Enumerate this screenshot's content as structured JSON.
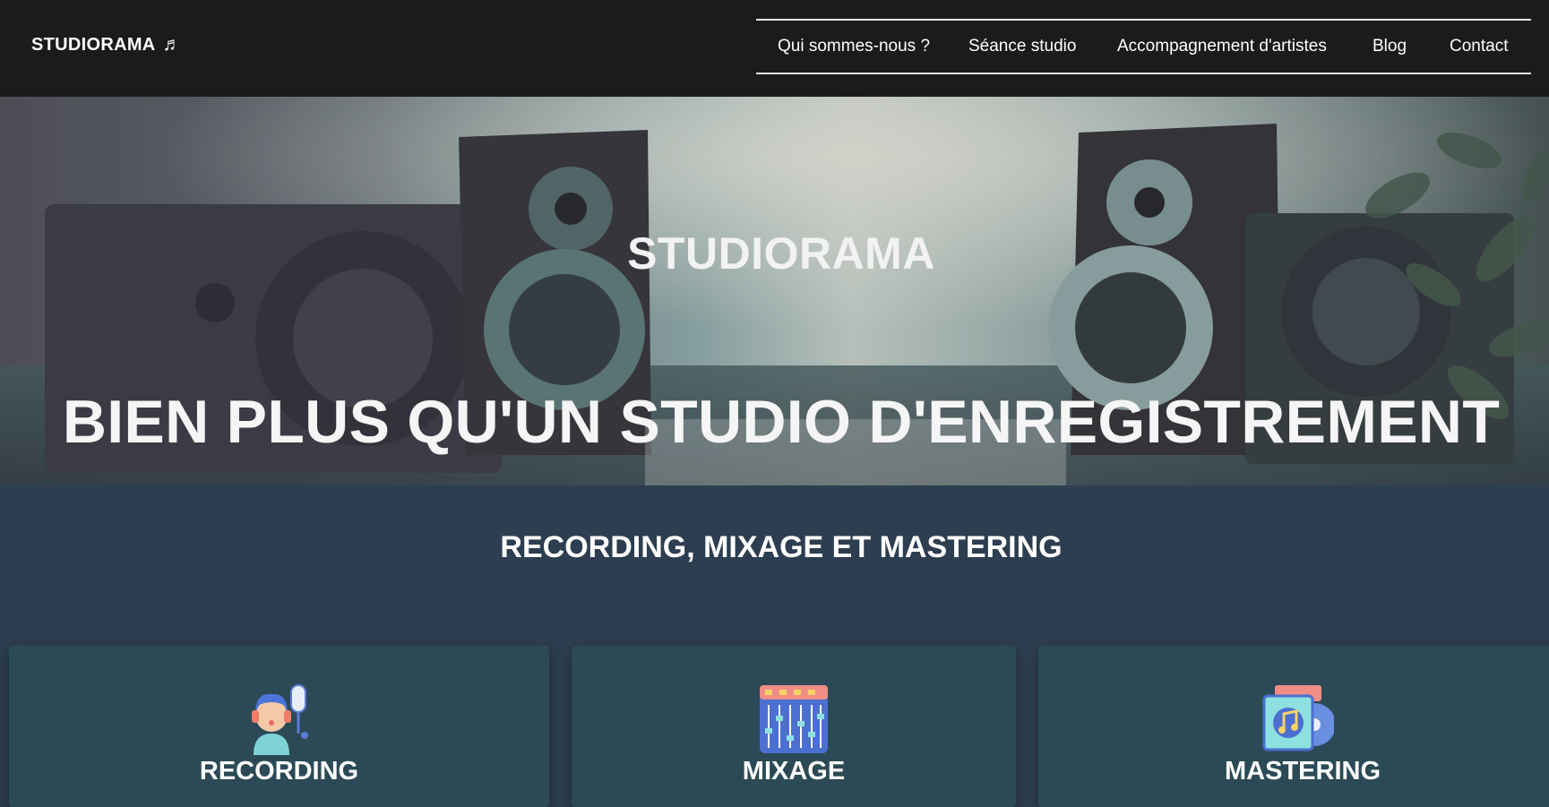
{
  "header": {
    "brand": "STUDIORAMA",
    "brand_icon": "♬",
    "nav": [
      {
        "label": "Qui sommes-nous ?"
      },
      {
        "label": "Séance studio"
      },
      {
        "label": "Accompagnement d'artistes"
      },
      {
        "label": "Blog"
      },
      {
        "label": "Contact"
      }
    ]
  },
  "hero": {
    "subtitle": "STUDIORAMA",
    "title": "BIEN PLUS QU'UN STUDIO D'ENREGISTREMENT"
  },
  "services": {
    "heading": "RECORDING, MIXAGE ET MASTERING",
    "cards": [
      {
        "label": "RECORDING",
        "icon": "singer-microphone-icon"
      },
      {
        "label": "MIXAGE",
        "icon": "mixing-console-icon"
      },
      {
        "label": "MASTERING",
        "icon": "music-album-icon"
      }
    ]
  },
  "colors": {
    "header_bg": "#1b1b1b",
    "page_bg": "#2d3e50",
    "card_bg": "#2b4a56"
  }
}
